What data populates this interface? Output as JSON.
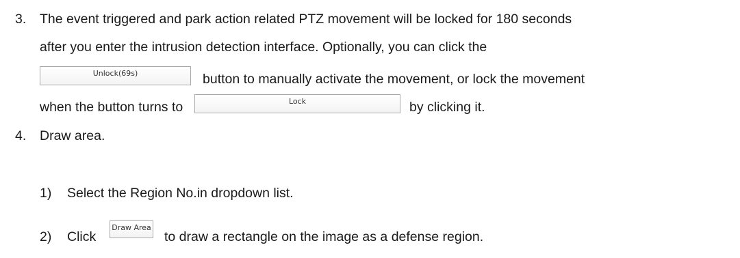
{
  "steps": [
    {
      "number": "3.",
      "line1": "The event triggered and park action related PTZ movement will be locked for 180 seconds",
      "line2": "after you enter the intrusion detection interface. Optionally, you can click the",
      "line3_after": "button to manually activate the movement, or lock the movement",
      "line4_before": "when the button turns to",
      "line4_after": "by clicking it."
    },
    {
      "number": "4.",
      "text": "Draw area."
    }
  ],
  "substeps": [
    {
      "number": "1)",
      "text": "Select the Region No.in dropdown list."
    },
    {
      "number": "2)",
      "before": "Click",
      "after": "to draw a rectangle on the image as a defense region."
    }
  ],
  "buttons": {
    "unlock": "Unlock(69s)",
    "lock": "Lock",
    "draw_area": "Draw Area"
  }
}
